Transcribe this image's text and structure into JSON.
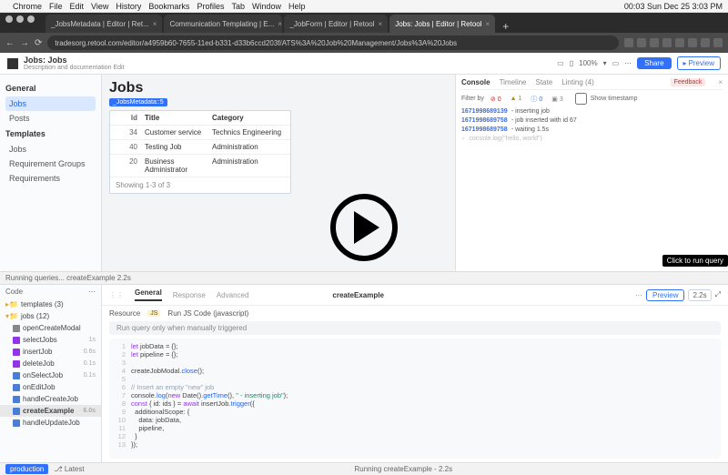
{
  "mac_menubar": {
    "items": [
      "Chrome",
      "File",
      "Edit",
      "View",
      "History",
      "Bookmarks",
      "Profiles",
      "Tab",
      "Window",
      "Help"
    ],
    "rhs": "00:03   Sun Dec 25  3:03 PM"
  },
  "chrome": {
    "tabs": [
      {
        "label": "_JobsMetadata | Editor | Ret..."
      },
      {
        "label": "Communication Templating | E..."
      },
      {
        "label": "_JobForm | Editor | Retool"
      },
      {
        "label": "Jobs: Jobs | Editor | Retool",
        "active": true
      }
    ],
    "url": "tradesorg.retool.com/editor/a4959b60-7655-11ed-b331-d33b6ccd203f/ATS%3A%20Job%20Management/Jobs%3A%20Jobs"
  },
  "app_header": {
    "title": "Jobs: Jobs",
    "subtitle": "Description and documentation  Edit",
    "zoom": "100%",
    "share": "Share",
    "preview": "Preview"
  },
  "left_nav": {
    "general_title": "General",
    "general_items": [
      "Jobs",
      "Posts"
    ],
    "templates_title": "Templates",
    "templates_items": [
      "Jobs",
      "Requirement Groups",
      "Requirements"
    ]
  },
  "canvas": {
    "badge_label": "_JobsMetadata::5",
    "title": "Jobs",
    "columns": {
      "id": "Id",
      "title": "Title",
      "category": "Category"
    },
    "rows": [
      {
        "id": "34",
        "title": "Customer service",
        "category": "Technics Engineering"
      },
      {
        "id": "40",
        "title": "Testing Job",
        "category": "Administration"
      },
      {
        "id": "20",
        "title": "Business Administrator",
        "category": "Administration"
      }
    ],
    "footer": "Showing 1-3 of 3"
  },
  "debug": {
    "tabs": [
      "Console",
      "Timeline",
      "State",
      "Linting (4)"
    ],
    "feedback": "Feedback",
    "filter_label": "Filter by",
    "counts": {
      "error": "0",
      "warn": "1",
      "info": "0",
      "log": "3"
    },
    "timestamp_label": "Show timestamp",
    "logs": [
      {
        "ts": "1671998689139",
        "msg": "- inserting job"
      },
      {
        "ts": "1671998689758",
        "msg": "- job inserted with id  67"
      },
      {
        "ts": "1671998689758",
        "msg": "- waiting 1.5s"
      }
    ],
    "prompt": "console.log(\"hello, world\")"
  },
  "running_bar": "Running queries... createExample 2.2s",
  "code_tree": {
    "header": "Code",
    "folders": [
      {
        "label": "templates (3)"
      },
      {
        "label": "jobs (12)",
        "open": true
      }
    ],
    "items": [
      {
        "label": "openCreateModal",
        "type": "modal",
        "timing": ""
      },
      {
        "label": "selectJobs",
        "type": "sql",
        "timing": "1s"
      },
      {
        "label": "insertJob",
        "type": "sql",
        "timing": "0.6s"
      },
      {
        "label": "deleteJob",
        "type": "sql",
        "timing": "0.1s"
      },
      {
        "label": "onSelectJob",
        "type": "js",
        "timing": "0.1s"
      },
      {
        "label": "onEditJob",
        "type": "js",
        "timing": ""
      },
      {
        "label": "handleCreateJob",
        "type": "js",
        "timing": ""
      },
      {
        "label": "createExample",
        "type": "js",
        "timing": "6.0s",
        "sel": true,
        "badge": "•"
      },
      {
        "label": "handleUpdateJob",
        "type": "js",
        "timing": ""
      }
    ]
  },
  "query_editor": {
    "tabs": [
      "General",
      "Response",
      "Advanced"
    ],
    "name": "createExample",
    "preview": "Preview",
    "timing": "2.2s",
    "resource_label": "Resource",
    "resource_value": "Run JS Code (javascript)",
    "trigger_note": "Run query only when manually triggered",
    "code_lines": [
      "let jobData = {};",
      "let pipeline = {};",
      "",
      "createJobModal.close();",
      "",
      "// Insert an empty \"new\" job",
      "console.log(new Date().getTime(), \" - inserting job\");",
      "const { id: ids } = await insertJob.trigger({",
      "  additionalScope: {",
      "    data: jobData,",
      "    pipeline,",
      "  }",
      "});"
    ]
  },
  "footer": {
    "env": "production",
    "latest": "Latest",
    "status": "Running createExample - 2.2s"
  },
  "tooltip": "Click to run query"
}
